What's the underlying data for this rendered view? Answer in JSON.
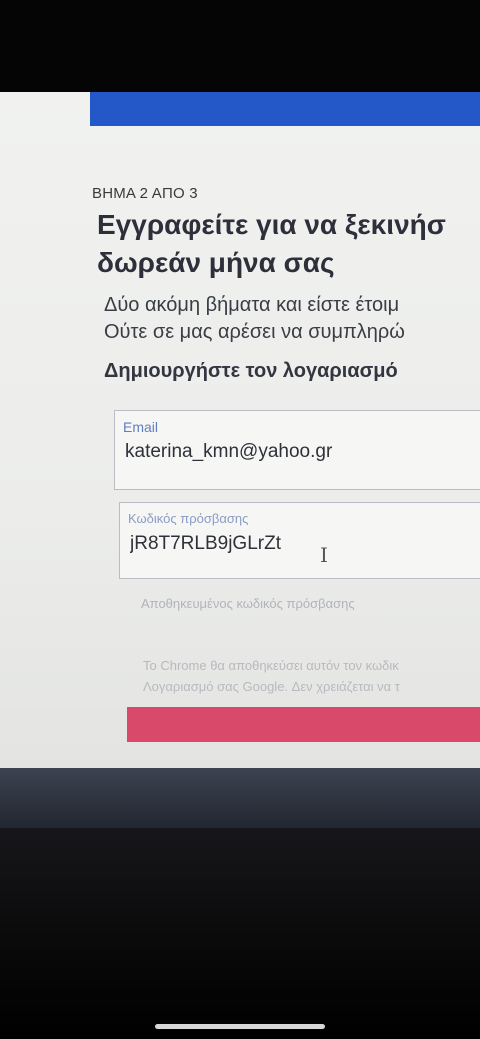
{
  "page": {
    "step": "ΒΗΜΑ 2 ΑΠΟ 3",
    "heading_line1": "Εγγραφείτε για να ξεκινήσ",
    "heading_line2": "δωρεάν μήνα σας",
    "subtext_line1": "Δύο ακόμη βήματα και είστε έτοιμ",
    "subtext_line2": "Ούτε σε μας αρέσει να συμπληρώ",
    "create_account_title": "Δημιουργήστε τον λογαριασμό"
  },
  "form": {
    "email_label": "Email",
    "email_value": "katerina_kmn@yahoo.gr",
    "password_label": "Κωδικός πρόσβασης",
    "password_value": "jR8T7RLB9jGLrZt",
    "saved_password_note": "Αποθηκευμένος κωδικός πρόσβασης",
    "chrome_note_line1": "Το Chrome θα αποθηκεύσει αυτόν τον κωδικ",
    "chrome_note_line2": "Λογαριασμό σας Google. Δεν χρειάζεται να τ"
  },
  "colors": {
    "top_bar": "#2457c7",
    "submit_button": "#d8496a",
    "label_blue": "#5f7ec4"
  }
}
